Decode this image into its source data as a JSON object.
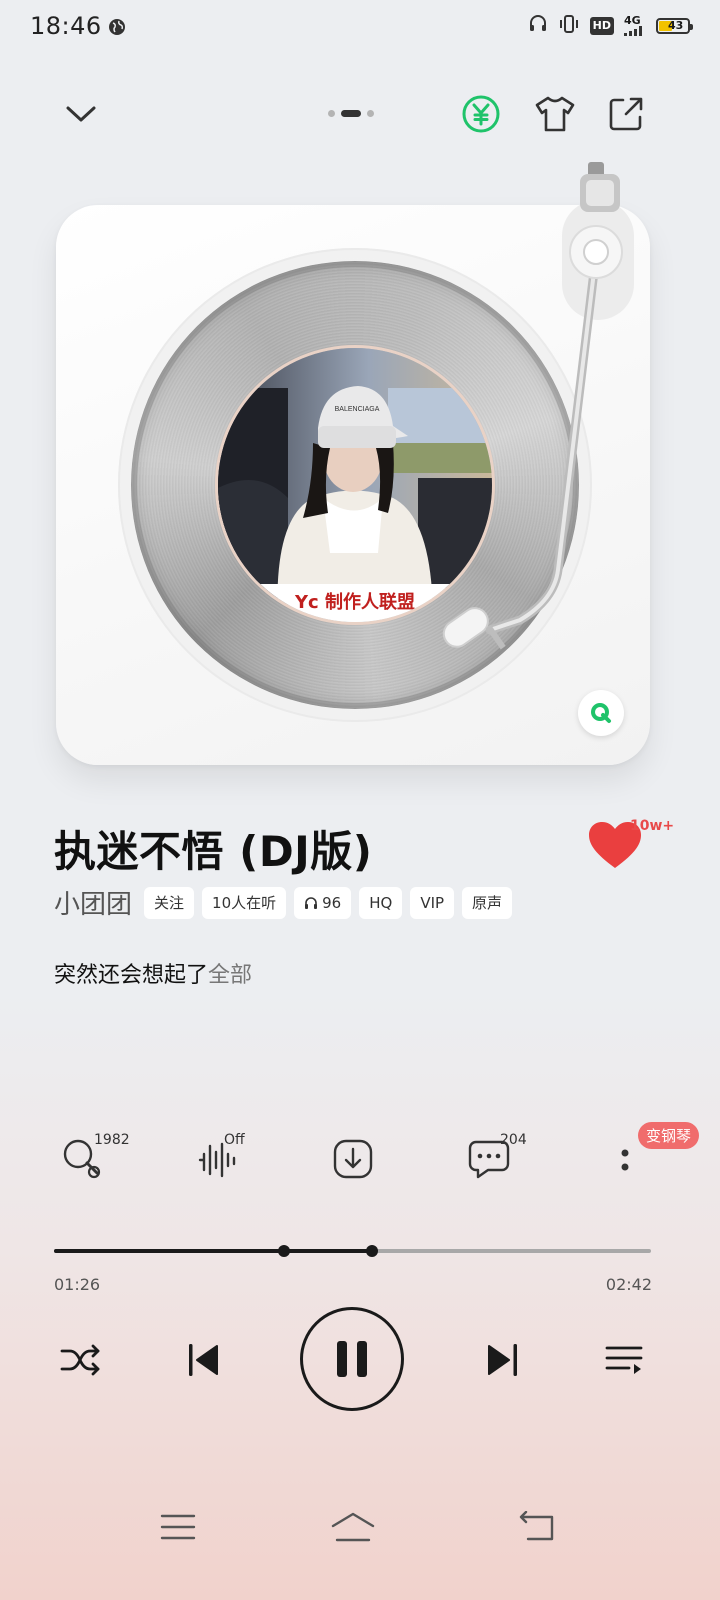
{
  "status_bar": {
    "time": "18:46",
    "hd": "HD",
    "network": "4G",
    "battery": "43"
  },
  "header": {
    "collapse_icon": "chevron-down-icon",
    "vip_icon": "yuan-coin-icon",
    "skin_icon": "tshirt-icon",
    "share_icon": "share-icon",
    "page_count": 3,
    "active_page": 2
  },
  "album": {
    "cover_text": "Yc 制作人联盟",
    "cap_text": "BALENCIAGA"
  },
  "song": {
    "title": "执迷不悟 (DJ版)",
    "artist": "小团团",
    "like_count": "10w+",
    "tags": [
      {
        "label": "关注",
        "icon": ""
      },
      {
        "label": "10人在听",
        "icon": ""
      },
      {
        "label": "96",
        "icon": "headphones-icon"
      },
      {
        "label": "HQ",
        "icon": ""
      },
      {
        "label": "VIP",
        "icon": ""
      },
      {
        "label": "原声",
        "icon": ""
      }
    ]
  },
  "lyric": {
    "line": "突然还会想起了",
    "more_label": "全部"
  },
  "actions": {
    "search_count": "1982",
    "effect_state": "Off",
    "comment_count": "204",
    "piano_badge": "变钢琴"
  },
  "progress": {
    "current": "01:26",
    "total": "02:42",
    "played_fraction": 0.532,
    "buffer_marker_fraction": 0.385
  },
  "colors": {
    "accent_green": "#1fc36a",
    "like_red": "#ea3f3f",
    "badge_red": "#f06c6c"
  }
}
